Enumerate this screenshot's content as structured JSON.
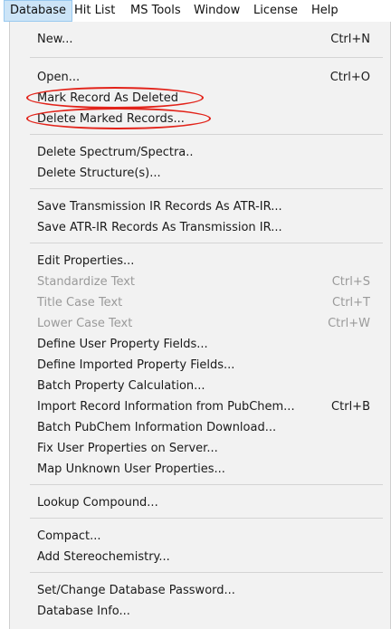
{
  "menubar": {
    "items": [
      {
        "label": "Database"
      },
      {
        "label": "Hit List"
      },
      {
        "label": "MS Tools"
      },
      {
        "label": "Window"
      },
      {
        "label": "License"
      },
      {
        "label": "Help"
      }
    ]
  },
  "menu": {
    "items": [
      {
        "label": "New...",
        "shortcut": "Ctrl+N"
      },
      {
        "label": "Open...",
        "shortcut": "Ctrl+O"
      },
      {
        "label": "Mark Record As Deleted",
        "shortcut": ""
      },
      {
        "label": "Delete Marked Records...",
        "shortcut": ""
      },
      {
        "label": "Delete Spectrum/Spectra..",
        "shortcut": ""
      },
      {
        "label": "Delete Structure(s)...",
        "shortcut": ""
      },
      {
        "label": "Save Transmission IR Records As ATR-IR...",
        "shortcut": ""
      },
      {
        "label": "Save ATR-IR Records As Transmission IR...",
        "shortcut": ""
      },
      {
        "label": "Edit Properties...",
        "shortcut": ""
      },
      {
        "label": "Standardize Text",
        "shortcut": "Ctrl+S",
        "disabled": true
      },
      {
        "label": "Title Case Text",
        "shortcut": "Ctrl+T",
        "disabled": true
      },
      {
        "label": "Lower Case Text",
        "shortcut": "Ctrl+W",
        "disabled": true
      },
      {
        "label": "Define User Property Fields...",
        "shortcut": ""
      },
      {
        "label": "Define Imported Property Fields...",
        "shortcut": ""
      },
      {
        "label": "Batch Property Calculation...",
        "shortcut": ""
      },
      {
        "label": "Import Record Information from PubChem...",
        "shortcut": "Ctrl+B"
      },
      {
        "label": "Batch PubChem Information Download...",
        "shortcut": ""
      },
      {
        "label": "Fix User Properties on Server...",
        "shortcut": ""
      },
      {
        "label": "Map Unknown User Properties...",
        "shortcut": ""
      },
      {
        "label": "Lookup Compound...",
        "shortcut": ""
      },
      {
        "label": "Compact...",
        "shortcut": ""
      },
      {
        "label": "Add Stereochemistry...",
        "shortcut": ""
      },
      {
        "label": "Set/Change Database Password...",
        "shortcut": ""
      },
      {
        "label": "Database Info...",
        "shortcut": ""
      }
    ]
  },
  "annotations": {
    "color": "#e2231a"
  },
  "colors": {
    "menu_bg": "#f2f2f2",
    "active_menubar_bg": "#cce4f7",
    "disabled_text": "#9a9a9a"
  }
}
